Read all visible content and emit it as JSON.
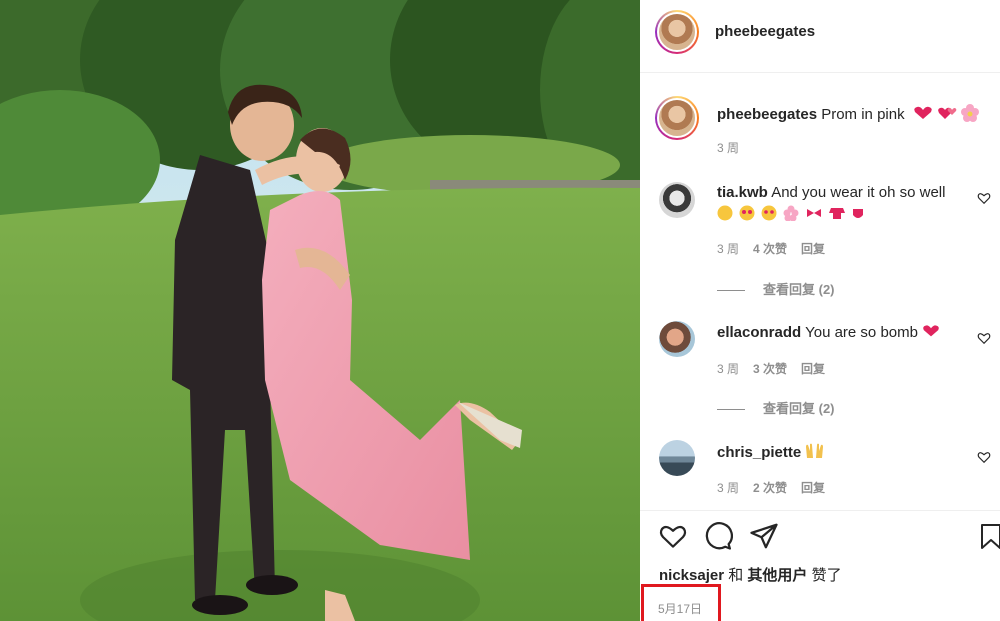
{
  "post": {
    "author": "pheebeegates",
    "caption_user": "pheebeegates",
    "caption_text": "Prom in pink",
    "caption_time": "3 周"
  },
  "comments": [
    {
      "user": "tia.kwb",
      "text": "And you wear it oh so well",
      "time": "3 周",
      "likes": "4 次赞",
      "reply": "回复",
      "view_replies": "查看回复 (2)"
    },
    {
      "user": "ellaconradd",
      "text": "You are so bomb",
      "time": "3 周",
      "likes": "3 次赞",
      "reply": "回复",
      "view_replies": "查看回复 (2)"
    },
    {
      "user": "chris_piette",
      "text": "",
      "time": "3 周",
      "likes": "2 次赞",
      "reply": "回复"
    }
  ],
  "likes_line": {
    "user": "nicksajer",
    "and": "和",
    "others": "其他用户",
    "liked": "赞了"
  },
  "date": "5月17日",
  "colors": {
    "highlight_box": "#e0181f",
    "heart": "#ed4956",
    "muted": "#8e8e8e"
  }
}
